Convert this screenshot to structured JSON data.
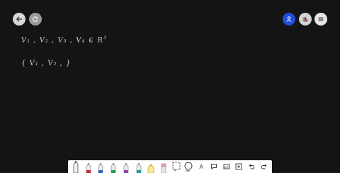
{
  "top_bar": {
    "back": {
      "icon": "arrow-left-icon"
    },
    "redo": {
      "icon": "redo-icon"
    },
    "user": {
      "icon": "person-icon",
      "color": "#1f4fd8"
    },
    "avatar": {
      "icon": "avatar-icon"
    },
    "menu": {
      "icon": "hamburger-menu-icon"
    }
  },
  "canvas": {
    "line1": "V₁ , V₂ , V₃ , V₄ ∈ R",
    "line1_sup": "3",
    "line2": "{ V₁ , V₂ , }"
  },
  "toolbar": {
    "tools": [
      {
        "name": "pencil-tool",
        "icon": "pencil-icon"
      },
      {
        "name": "red-pen-tool",
        "icon": "pen-icon",
        "color": "#d21f3c"
      },
      {
        "name": "blue-pen-tool",
        "icon": "pen-icon",
        "color": "#2a62c9"
      },
      {
        "name": "green-pen-tool",
        "icon": "pen-icon",
        "color": "#1e9b4a"
      },
      {
        "name": "purple-pen-tool",
        "icon": "pen-icon",
        "color": "#8b3fb5"
      },
      {
        "name": "teal-pen-tool",
        "icon": "pen-icon",
        "color": "#1aa0a0"
      },
      {
        "name": "highlighter-tool",
        "icon": "highlighter-icon",
        "color": "#f2c21b"
      },
      {
        "name": "eraser-tool",
        "icon": "eraser-icon",
        "color": "#f4a0b6"
      },
      {
        "name": "select-tool",
        "icon": "lasso-select-icon"
      },
      {
        "name": "shape-tool",
        "icon": "circle-shape-icon"
      },
      {
        "name": "text-tool",
        "icon": "text-icon",
        "label": "A"
      },
      {
        "name": "comment-tool",
        "icon": "speech-bubble-icon"
      },
      {
        "name": "image-tool",
        "icon": "image-icon"
      },
      {
        "name": "add-tool",
        "icon": "plus-square-icon"
      },
      {
        "name": "undo-tool",
        "icon": "undo-icon"
      },
      {
        "name": "redo-tool",
        "icon": "redo-icon"
      }
    ]
  }
}
